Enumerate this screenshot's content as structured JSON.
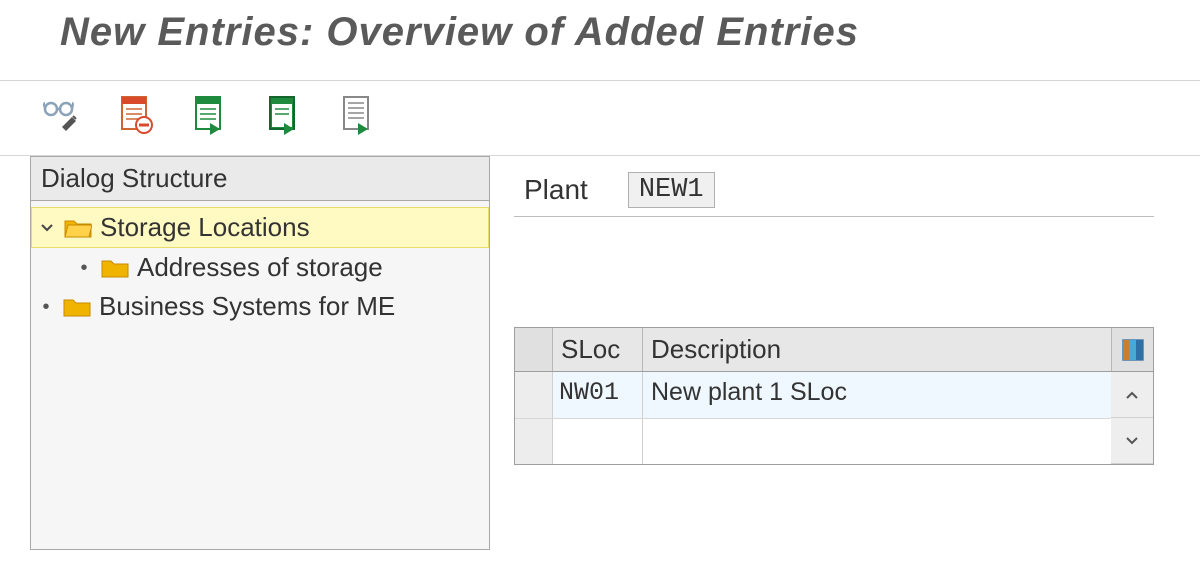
{
  "title": "New Entries: Overview of Added Entries",
  "toolbar": {
    "icons": [
      "display-change-icon",
      "delete-row-icon",
      "select-all-icon",
      "deselect-all-icon",
      "configuration-icon"
    ]
  },
  "left": {
    "header": "Dialog Structure",
    "nodes": [
      {
        "expanded": true,
        "highlight": true,
        "label": "Storage Locations",
        "children": [
          {
            "label": "Addresses of storage"
          }
        ]
      },
      {
        "expanded": false,
        "highlight": false,
        "label": "Business Systems for ME"
      }
    ]
  },
  "right": {
    "field_label": "Plant",
    "field_value": "NEW1",
    "grid": {
      "col_sloc": "SLoc",
      "col_desc": "Description",
      "rows": [
        {
          "sloc": "NW01",
          "desc": "New plant 1 SLoc"
        },
        {
          "sloc": "",
          "desc": ""
        }
      ]
    }
  }
}
